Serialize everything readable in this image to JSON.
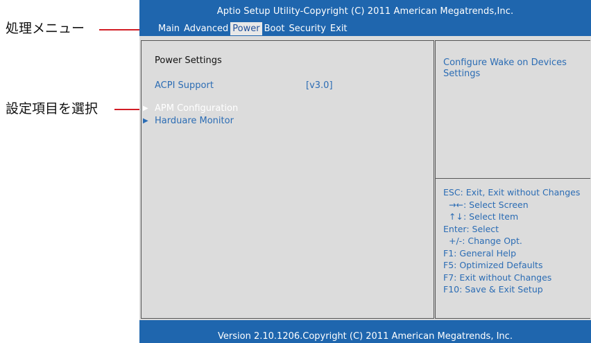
{
  "annotations": {
    "menu_label": "処理メニュー",
    "select_label": "設定項目を選択"
  },
  "header": {
    "title": "Aptio Setup Utility-Copyright (C) 2011 American Megatrends,Inc."
  },
  "menu": {
    "items": [
      "Main",
      "Advanced",
      "Power",
      "Boot",
      "Security",
      "Exit"
    ],
    "active": "Power"
  },
  "main": {
    "section_title": "Power  Settings",
    "acpi_label": "ACPI Support",
    "acpi_value": "[v3.0]",
    "submenus": [
      {
        "label": "APM Configuration",
        "selected": true
      },
      {
        "label": "Harduare Monitor",
        "selected": false
      }
    ]
  },
  "help": {
    "description": "Configure  Wake on Devices Settings",
    "keys": [
      "ESC: Exit, Exit without Changes",
      "→←: Select Screen",
      "↑↓: Select Item",
      "Enter: Select",
      "+/-: Change Opt.",
      "F1: General Help",
      "F5: Optimized Defaults",
      "F7: Exit without Changes",
      "F10: Save & Exit Setup"
    ]
  },
  "footer": {
    "version": "Version 2.10.1206.Copyright (C) 2011 American Megatrends, Inc."
  },
  "colors": {
    "header_bg": "#1f66ae",
    "text_blue": "#2b6cb4",
    "annotation_line": "#d21d25",
    "panel_bg": "#dcdcdc"
  }
}
